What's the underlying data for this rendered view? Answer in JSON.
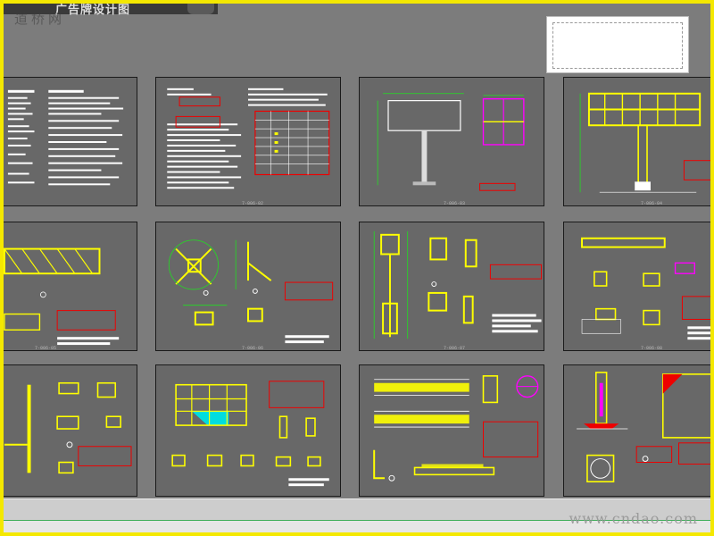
{
  "window": {
    "title": "广告牌设计图"
  },
  "watermarks": {
    "top_left": "道桥网",
    "bottom_right": "www.cndao.com"
  },
  "sheets": [
    {
      "label": "7-006-01"
    },
    {
      "label": "7-006-02"
    },
    {
      "label": "7-006-03"
    },
    {
      "label": "7-006-04"
    },
    {
      "label": "7-006-05"
    },
    {
      "label": "7-006-06"
    },
    {
      "label": "7-006-07"
    },
    {
      "label": "7-006-08"
    },
    {
      "label": "7-006-09"
    },
    {
      "label": "7-006-10"
    },
    {
      "label": "7-006-11"
    },
    {
      "label": "7-006-12"
    }
  ],
  "colors": {
    "frame_border": "#f4e800",
    "model_space_bg": "#7c7c7c",
    "sheet_bg": "#686868",
    "line_white": "#ffffff",
    "line_red": "#e00000",
    "line_green": "#22dd22",
    "line_yellow": "#ffff00",
    "line_magenta": "#ff00ff",
    "fill_cyan": "#00e0e0"
  }
}
